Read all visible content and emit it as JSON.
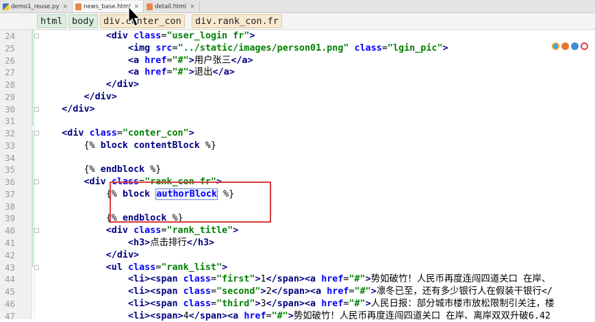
{
  "tabs": [
    {
      "label": "demo1_reuse.py",
      "icon": "python-file-icon"
    },
    {
      "label": "news_base.html",
      "icon": "html-file-icon",
      "active": true
    },
    {
      "label": "detail.html",
      "icon": "html-file-icon"
    }
  ],
  "breadcrumb": [
    "html",
    "body",
    "div.conter_con",
    "div.rank_con.fr"
  ],
  "lines": [
    {
      "n": "24",
      "html": "            <span class=\"t\">&lt;div</span> <span class=\"a\">class</span>=<span class=\"s\">\"user_login fr\"</span><span class=\"t\">&gt;</span>",
      "marker": true
    },
    {
      "n": "25",
      "html": "                <span class=\"t\">&lt;img</span> <span class=\"a\">src</span>=<span class=\"s\">\"../static/images/person01.png\"</span> <span class=\"a\">class</span>=<span class=\"s\">\"lgin_pic\"</span><span class=\"t\">&gt;</span>"
    },
    {
      "n": "26",
      "html": "                <span class=\"t\">&lt;a</span> <span class=\"a\">href</span>=<span class=\"s\">\"#\"</span><span class=\"t\">&gt;</span>用户张三<span class=\"t\">&lt;/a&gt;</span>"
    },
    {
      "n": "27",
      "html": "                <span class=\"t\">&lt;a</span> <span class=\"a\">href</span>=<span class=\"s\">\"#\"</span><span class=\"t\">&gt;</span>退出<span class=\"t\">&lt;/a&gt;</span>"
    },
    {
      "n": "28",
      "html": "            <span class=\"t\">&lt;/div&gt;</span>"
    },
    {
      "n": "29",
      "html": "        <span class=\"t\">&lt;/div&gt;</span>"
    },
    {
      "n": "30",
      "html": "    <span class=\"t\">&lt;/div&gt;</span>",
      "marker": true
    },
    {
      "n": "31",
      "html": ""
    },
    {
      "n": "32",
      "html": "    <span class=\"t\">&lt;div</span> <span class=\"a\">class</span>=<span class=\"s\">\"conter_con\"</span><span class=\"t\">&gt;</span>",
      "marker": true
    },
    {
      "n": "33",
      "html": "        {% <span class=\"kw\">block</span> <span class=\"kw\">contentBlock</span> %}"
    },
    {
      "n": "34",
      "html": ""
    },
    {
      "n": "35",
      "html": "        {% <span class=\"kw\">endblock</span> %}"
    },
    {
      "n": "36",
      "html": "        <span class=\"t\">&lt;div</span> <span class=\"a\">class</span>=<span class=\"s\">\"rank_con fr\"</span><span class=\"t\">&gt;</span>",
      "marker": true
    },
    {
      "n": "37",
      "html": "            {% <span class=\"kw\">block</span> <span class=\"bx\">authorBlock</span> %}"
    },
    {
      "n": "38",
      "html": ""
    },
    {
      "n": "39",
      "html": "            {% <span class=\"kw\">endblock</span> %}"
    },
    {
      "n": "40",
      "html": "            <span class=\"t\">&lt;div</span> <span class=\"a\">class</span>=<span class=\"s\">\"rank_title\"</span><span class=\"t\">&gt;</span>",
      "marker": true
    },
    {
      "n": "41",
      "html": "                <span class=\"t\">&lt;h3&gt;</span>点击排行<span class=\"t\">&lt;/h3&gt;</span>"
    },
    {
      "n": "42",
      "html": "            <span class=\"t\">&lt;/div&gt;</span>"
    },
    {
      "n": "43",
      "html": "            <span class=\"t\">&lt;ul</span> <span class=\"a\">class</span>=<span class=\"s\">\"rank_list\"</span><span class=\"t\">&gt;</span>",
      "marker": true
    },
    {
      "n": "44",
      "html": "                <span class=\"t\">&lt;li&gt;&lt;span</span> <span class=\"a\">class</span>=<span class=\"s\">\"first\"</span><span class=\"t\">&gt;</span>1<span class=\"t\">&lt;/span&gt;&lt;a</span> <span class=\"a\">href</span>=<span class=\"s\">\"#\"</span><span class=\"t\">&gt;</span>势如破竹！人民币再度连闯四道关口 在岸、"
    },
    {
      "n": "45",
      "html": "                <span class=\"t\">&lt;li&gt;&lt;span</span> <span class=\"a\">class</span>=<span class=\"s\">\"second\"</span><span class=\"t\">&gt;</span>2<span class=\"t\">&lt;/span&gt;&lt;a</span> <span class=\"a\">href</span>=<span class=\"s\">\"#\"</span><span class=\"t\">&gt;</span>凛冬已至，还有多少银行人在假装干银行&lt;/"
    },
    {
      "n": "46",
      "html": "                <span class=\"t\">&lt;li&gt;&lt;span</span> <span class=\"a\">class</span>=<span class=\"s\">\"third\"</span><span class=\"t\">&gt;</span>3<span class=\"t\">&lt;/span&gt;&lt;a</span> <span class=\"a\">href</span>=<span class=\"s\">\"#\"</span><span class=\"t\">&gt;</span>人民日报：部分城市楼市放松限制引关注，楼"
    },
    {
      "n": "47",
      "html": "                <span class=\"t\">&lt;li&gt;&lt;span&gt;</span>4<span class=\"t\">&lt;/span&gt;&lt;a</span> <span class=\"a\">href</span>=<span class=\"s\">\"#\"</span><span class=\"t\">&gt;</span>势如破竹！人民币再度连闯四道关口 在岸、离岸双双升破6.42"
    }
  ]
}
